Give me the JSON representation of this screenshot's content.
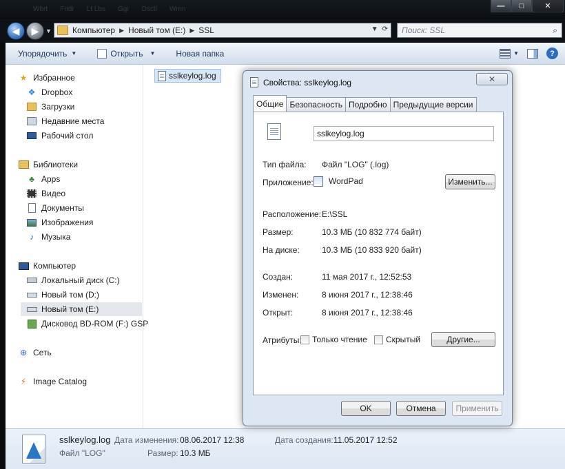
{
  "titlebar": {
    "ghost_tabs": [
      "Wbrt",
      "Fndr",
      "Lt Lbs",
      "Ggr",
      "Dsctl",
      "Wrnn"
    ],
    "minimize": "—",
    "maximize": "□",
    "close": "✕"
  },
  "address": {
    "crumbs": [
      "Компьютер",
      "Новый том (E:)",
      "SSL"
    ],
    "search_placeholder": "Поиск: SSL"
  },
  "toolbar": {
    "organize": "Упорядочить",
    "open": "Открыть",
    "new_folder": "Новая папка"
  },
  "sidebar": {
    "favorites": "Избранное",
    "dropbox": "Dropbox",
    "downloads": "Загрузки",
    "recent": "Недавние места",
    "desktop": "Рабочий стол",
    "libraries": "Библиотеки",
    "apps": "Apps",
    "video": "Видео",
    "documents": "Документы",
    "pictures": "Изображения",
    "music": "Музыка",
    "computer": "Компьютер",
    "drive_c": "Локальный диск (C:)",
    "drive_d": "Новый том (D:)",
    "drive_e": "Новый том (E:)",
    "drive_f": "Дисковод BD-ROM (F:) GSP",
    "network": "Сеть",
    "image_catalog": "Image Catalog"
  },
  "content": {
    "file_name": "sslkeylog.log"
  },
  "details": {
    "file_name": "sslkeylog.log",
    "modified_label": "Дата изменения:",
    "modified_value": "08.06.2017 12:38",
    "created_label": "Дата создания:",
    "created_value": "11.05.2017 12:52",
    "type_value": "Файл \"LOG\"",
    "size_label": "Размер:",
    "size_value": "10.3 МБ"
  },
  "dialog": {
    "title": "Свойства: sslkeylog.log",
    "close": "✕",
    "tabs": [
      "Общие",
      "Безопасность",
      "Подробно",
      "Предыдущие версии"
    ],
    "name": "sslkeylog.log",
    "type_label": "Тип файла:",
    "type_value": "Файл \"LOG\" (.log)",
    "app_label": "Приложение:",
    "app_value": "WordPad",
    "change_button": "Изменить...",
    "location_label": "Расположение:",
    "location_value": "E:\\SSL",
    "size_label": "Размер:",
    "size_value": "10.3 МБ (10 832 774 байт)",
    "disk_label": "На диске:",
    "disk_value": "10.3 МБ (10 833 920 байт)",
    "created_label": "Создан:",
    "created_value": "11 мая 2017 г., 12:52:53",
    "modified_label": "Изменен:",
    "modified_value": "8 июня 2017 г., 12:38:46",
    "opened_label": "Открыт:",
    "opened_value": "8 июня 2017 г., 12:38:46",
    "attributes_label": "Атрибуты:",
    "readonly_label": "Только чтение",
    "hidden_label": "Скрытый",
    "other_button": "Другие...",
    "ok": "OK",
    "cancel": "Отмена",
    "apply": "Применить"
  }
}
